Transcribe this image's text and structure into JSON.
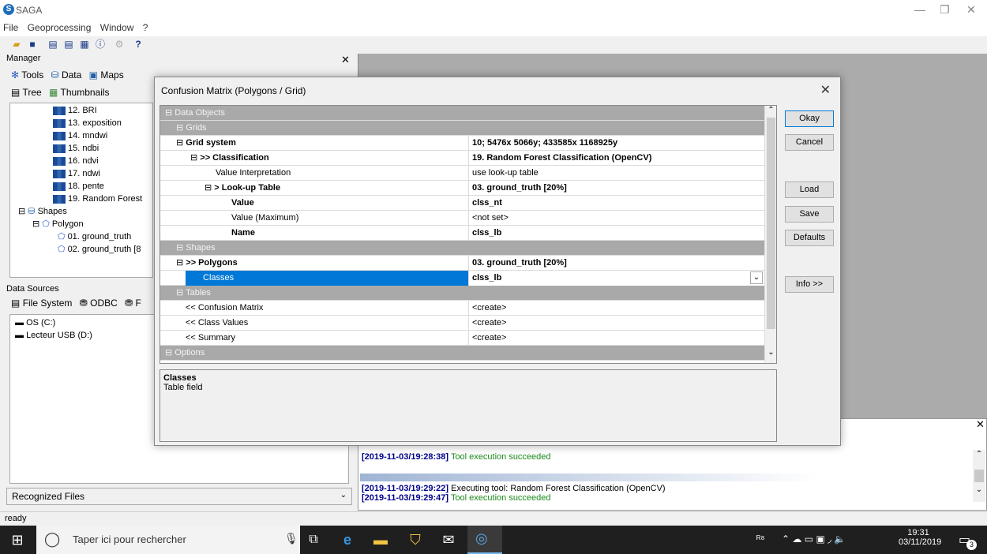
{
  "app": {
    "title": "SAGA",
    "logo": "saga-logo"
  },
  "window_controls": {
    "minimize": "—",
    "restore": "❐",
    "close": "✕"
  },
  "menu": [
    "File",
    "Geoprocessing",
    "Window",
    "?"
  ],
  "manager": {
    "title": "Manager",
    "tabs": [
      "Tools",
      "Data",
      "Maps"
    ],
    "subtabs": [
      "Tree",
      "Thumbnails"
    ],
    "tree": [
      "12. BRI",
      "13. exposition",
      "14. mndwi",
      "15. ndbi",
      "16. ndvi",
      "17. ndwi",
      "18. pente",
      "19. Random Forest"
    ],
    "shapes_label": "Shapes",
    "polygon_label": "Polygon",
    "polygon_items": [
      "01. ground_truth",
      "02. ground_truth [8"
    ]
  },
  "data_sources": {
    "title": "Data Sources",
    "tabs": [
      "File System",
      "ODBC",
      "F"
    ],
    "drives": [
      "OS (C:)",
      "Lecteur USB (D:)"
    ],
    "filter_value": "Recognized Files"
  },
  "dialog": {
    "title": "Confusion Matrix (Polygons / Grid)",
    "buttons": {
      "okay": "Okay",
      "cancel": "Cancel",
      "load": "Load",
      "save": "Save",
      "defaults": "Defaults",
      "info": "Info >>"
    },
    "sections": {
      "data_objects": "Data Objects",
      "grids": "Grids",
      "shapes": "Shapes",
      "tables": "Tables",
      "options": "Options"
    },
    "rows": {
      "grid_system": {
        "label": "Grid system",
        "value": "10; 5476x 5066y; 433585x 1168925y"
      },
      "classification": {
        "label": ">> Classification",
        "value": "19. Random Forest Classification (OpenCV)"
      },
      "value_interp": {
        "label": "Value Interpretation",
        "value": "use look-up table"
      },
      "lut": {
        "label": "> Look-up Table",
        "value": "03. ground_truth [20%]"
      },
      "value": {
        "label": "Value",
        "value": "clss_nt"
      },
      "value_max": {
        "label": "Value (Maximum)",
        "value": "<not set>"
      },
      "name": {
        "label": "Name",
        "value": "clss_lb"
      },
      "polygons": {
        "label": ">> Polygons",
        "value": "03. ground_truth [20%]"
      },
      "classes": {
        "label": "Classes",
        "value": "clss_lb"
      },
      "conf_matrix": {
        "label": "<< Confusion Matrix",
        "value": "<create>"
      },
      "class_values": {
        "label": "<< Class Values",
        "value": "<create>"
      },
      "summary": {
        "label": "<< Summary",
        "value": "<create>"
      }
    },
    "description": {
      "title": "Classes",
      "text": "Table field"
    }
  },
  "messages": [
    {
      "ts": "[2019-11-03/19:28:38]",
      "text": "Tool execution succeeded",
      "type": "ok"
    },
    {
      "ts": "[2019-11-03/19:29:22]",
      "text": "Executing tool: Random Forest Classification (OpenCV)",
      "type": "info"
    },
    {
      "ts": "[2019-11-03/19:29:47]",
      "text": "Tool execution succeeded",
      "type": "ok"
    }
  ],
  "status": {
    "text": "ready"
  },
  "taskbar": {
    "search_placeholder": "Taper ici pour rechercher",
    "time": "19:31",
    "date": "03/11/2019",
    "notif_count": "3"
  }
}
